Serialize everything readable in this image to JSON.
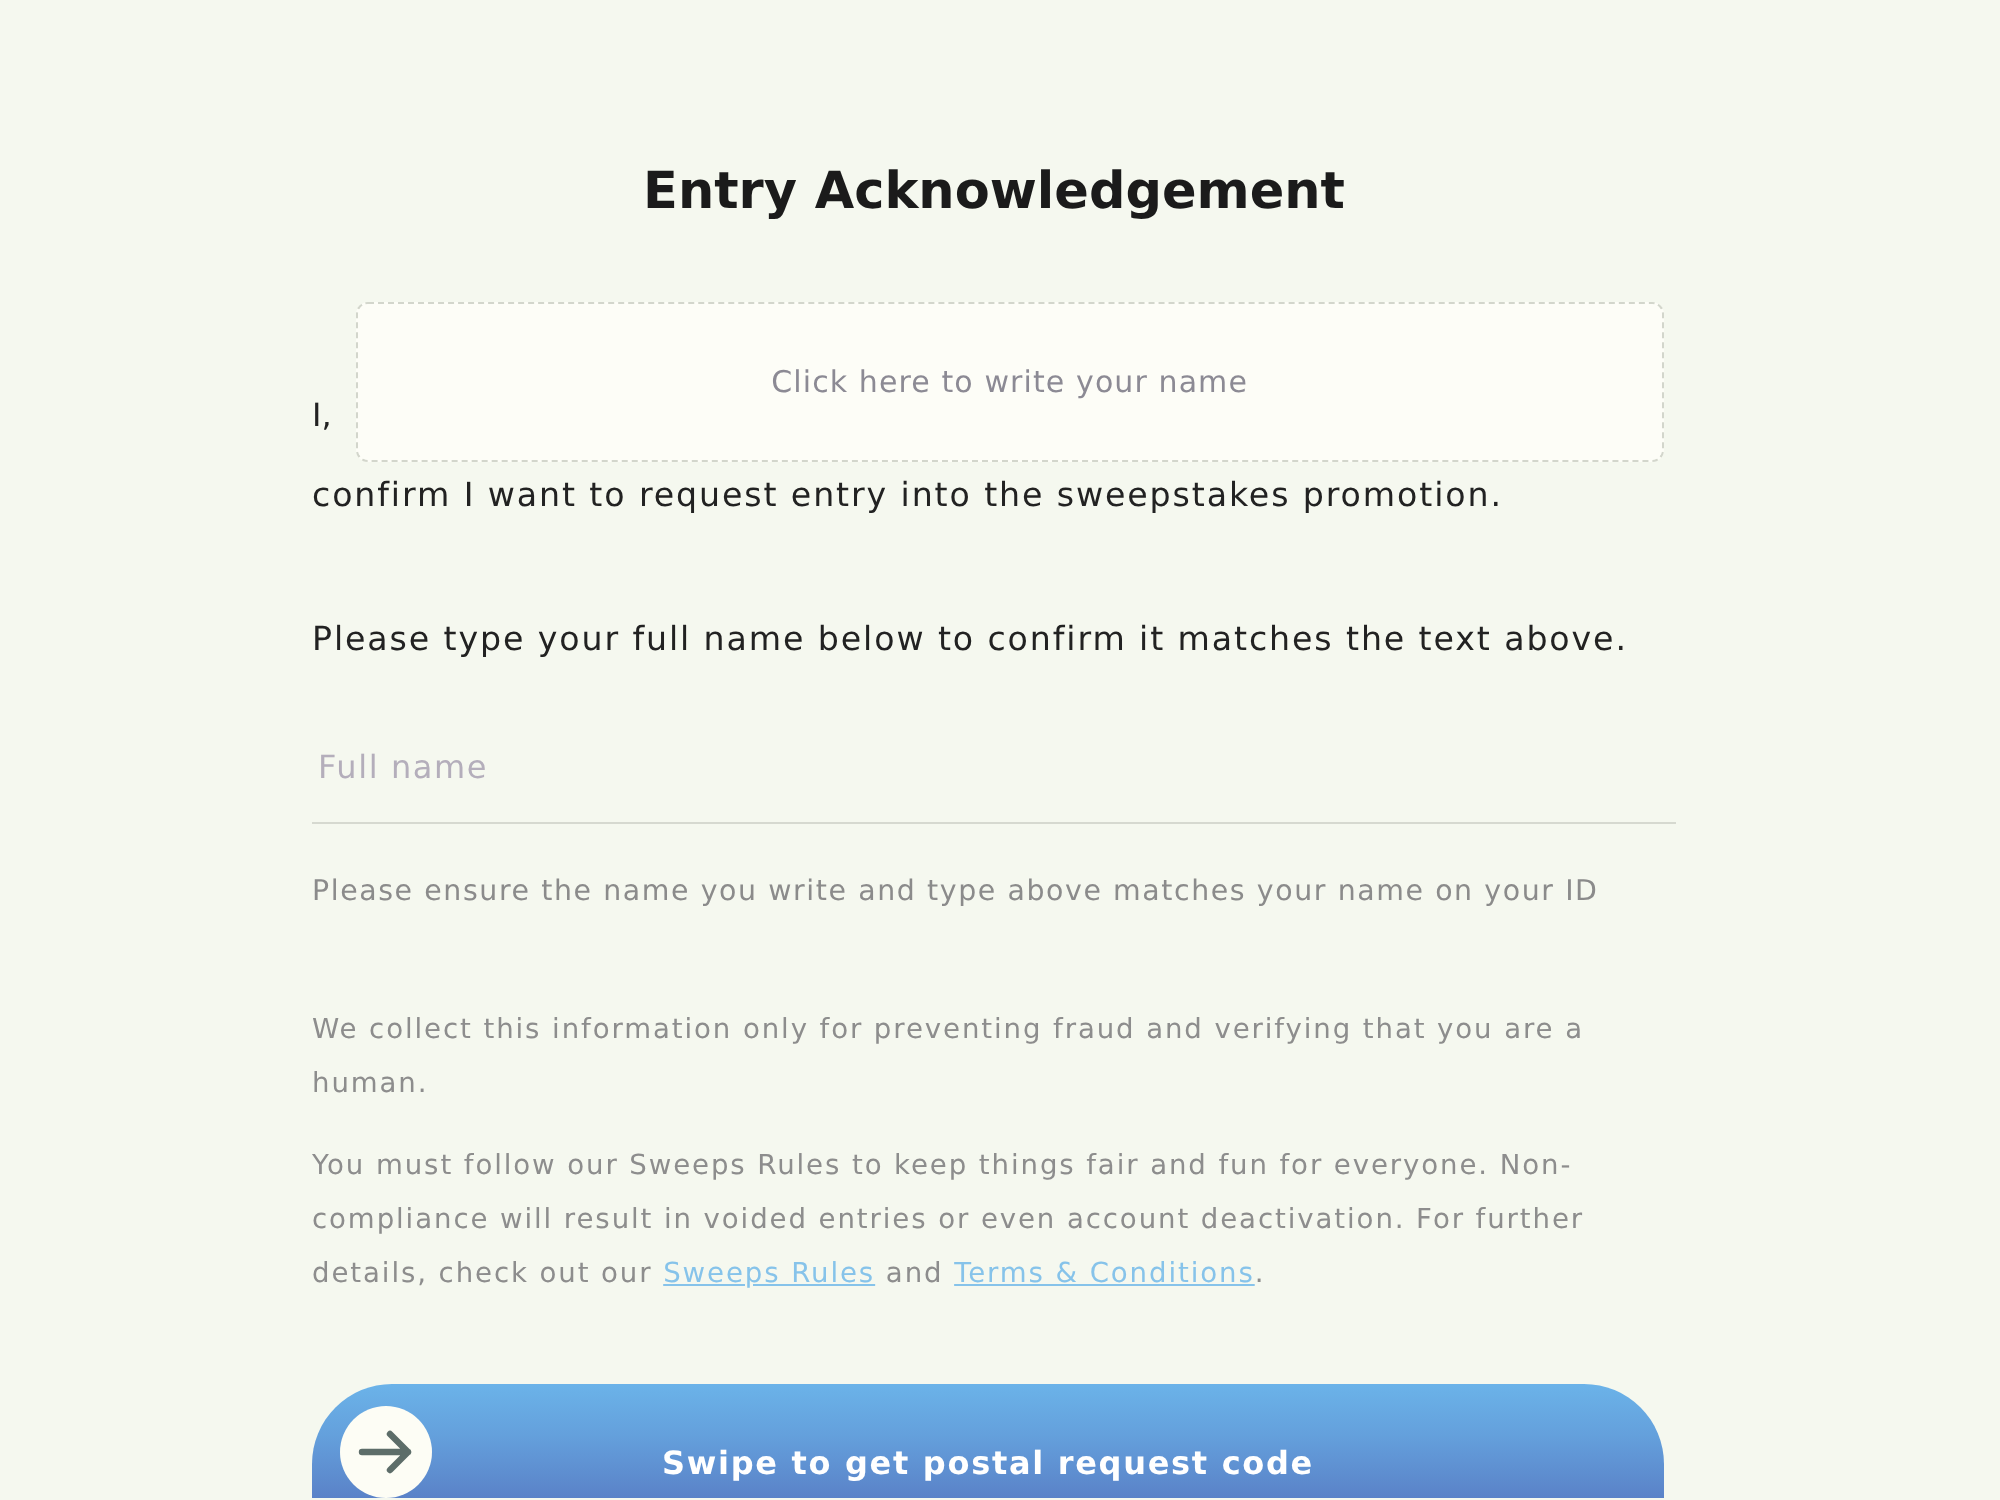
{
  "title": "Entry Acknowledgement",
  "signature": {
    "prefix": "I,",
    "placeholder": "Click here to write your name"
  },
  "confirmation": "confirm I want to request entry into the sweepstakes promotion.",
  "instruction": "Please type your full name below to confirm it matches the text above.",
  "name_field": {
    "placeholder": "Full name",
    "hint": "Please ensure the name you write and type above matches your name on your ID"
  },
  "notices": [
    [
      {
        "kind": "text",
        "text": "We collect this information only for preventing fraud and verifying that you are a human."
      }
    ],
    [
      {
        "kind": "text",
        "text": "You must follow our Sweeps Rules to keep things fair and fun for everyone. Non-compliance will result in voided entries or even account deactivation. For further details, check out our "
      },
      {
        "kind": "link",
        "text": "Sweeps Rules"
      },
      {
        "kind": "text",
        "text": " and "
      },
      {
        "kind": "link",
        "text": "Terms & Conditions"
      },
      {
        "kind": "text",
        "text": "."
      }
    ]
  ],
  "swipe": {
    "label": "Swipe to get postal request code",
    "level": 0
  }
}
